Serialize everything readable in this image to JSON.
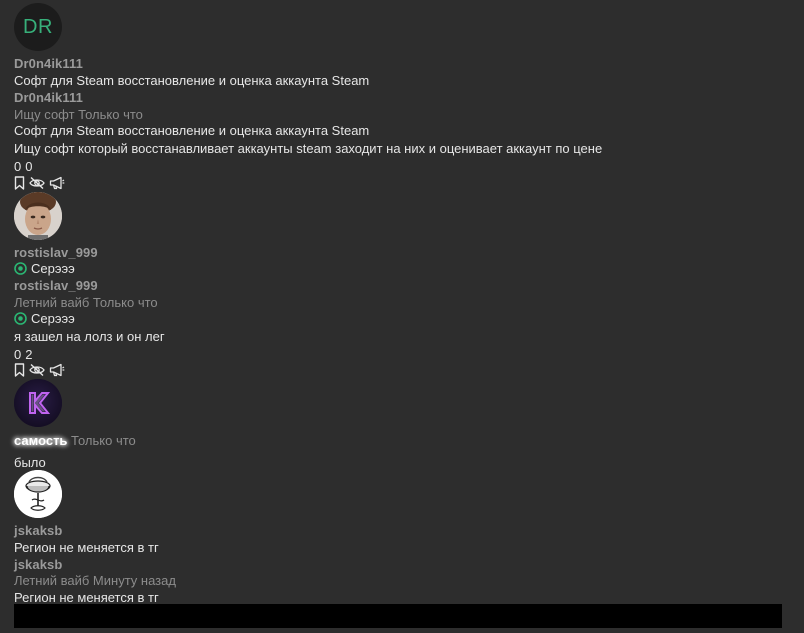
{
  "post1": {
    "avatar_initials": "DR",
    "author": "Dr0n4ik111",
    "title": "Софт для Steam восстановление и оценка аккаунта Steam",
    "last_author": "Dr0n4ik111",
    "meta_section": "Ищу софт",
    "meta_time": "Только что",
    "preview_title": "Софт для Steam восстановление и оценка аккаунта Steam",
    "preview_text": "Ищу софт который восстанавливает аккаунты steam заходит на них и оценивает аккаунт по цене",
    "count_a": "0",
    "count_b": "0"
  },
  "post2": {
    "author": "rostislav_999",
    "title": "Серэээ",
    "last_author": "rostislav_999",
    "meta_section": "Летний вайб",
    "meta_time": "Только что",
    "preview_title": "Серэээ",
    "preview_text": "я зашел на лолз и он лег",
    "count_a": "0",
    "count_b": "2",
    "status_color": "#2bb673"
  },
  "post3": {
    "author": "самость",
    "meta_time": "Только что",
    "text": "было",
    "avatar_accent": "#b04fe0"
  },
  "post4": {
    "author": "jskaksb",
    "title": "Регион не меняется в тг",
    "last_author": "jskaksb",
    "meta_section": "Летний вайб",
    "meta_time": "Минуту назад",
    "preview_title": "Регион не меняется в тг"
  },
  "icons": {
    "bookmark": "bookmark-icon",
    "hide": "eye-off-icon",
    "report": "megaphone-icon"
  }
}
